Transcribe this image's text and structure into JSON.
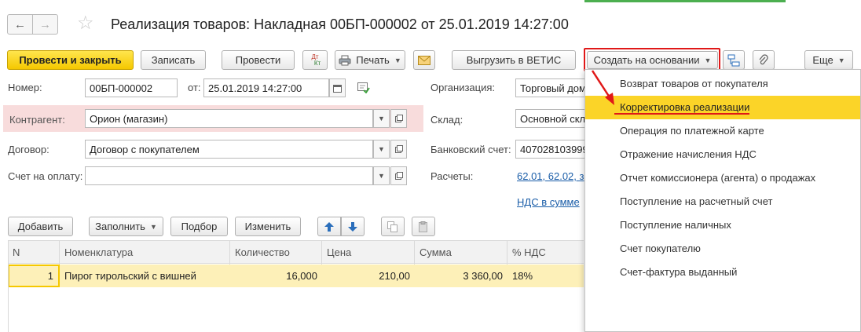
{
  "window": {
    "title": "Реализация товаров: Накладная 00БП-000002 от 25.01.2019 14:27:00",
    "back_glyph": "←",
    "forward_glyph": "→",
    "favorite_glyph": "☆"
  },
  "toolbar": {
    "post_close": "Провести и закрыть",
    "save": "Записать",
    "post": "Провести",
    "dt_kt_top": "Дт",
    "dt_kt_bottom": "Кт",
    "print": "Печать",
    "export_vetis": "Выгрузить в ВЕТИС",
    "create_based_on": "Создать на основании",
    "more": "Еще",
    "help": "?"
  },
  "form": {
    "number_label": "Номер:",
    "number_value": "00БП-000002",
    "date_label": "от:",
    "date_value": "25.01.2019 14:27:00",
    "org_label": "Организация:",
    "org_value": "Торговый дом",
    "counterparty_label": "Контрагент:",
    "counterparty_value": "Орион (магазин)",
    "warehouse_label": "Склад:",
    "warehouse_value": "Основной скл",
    "contract_label": "Договор:",
    "contract_value": "Договор с покупателем",
    "bank_label": "Банковский счет:",
    "bank_value": "407028103999",
    "invoice_label": "Счет на оплату:",
    "invoice_value": "",
    "settlements_label": "Расчеты:",
    "settlements_link": "62.01, 62.02, з",
    "vat_link": "НДС в сумме"
  },
  "table_toolbar": {
    "add": "Добавить",
    "fill": "Заполнить",
    "select": "Подбор",
    "change": "Изменить"
  },
  "table": {
    "columns": [
      "N",
      "Номенклатура",
      "Количество",
      "Цена",
      "Сумма",
      "% НДС"
    ],
    "rows": [
      [
        "1",
        "Пирог тирольский с вишней",
        "16,000",
        "210,00",
        "3 360,00",
        "18%"
      ]
    ]
  },
  "dropdown": {
    "items": [
      "Возврат товаров от покупателя",
      "Корректировка реализации",
      "Операция по платежной карте",
      "Отражение начисления НДС",
      "Отчет комиссионера (агента) о продажах",
      "Поступление на расчетный счет",
      "Поступление наличных",
      "Счет покупателю",
      "Счет-фактура выданный"
    ],
    "highlighted_index": 1
  },
  "colors": {
    "primary_button": "#f5c800",
    "highlight": "#fbd428",
    "annotation_red": "#e01818",
    "link": "#1a5da8",
    "selected_row": "#fdf0b8",
    "required_bg": "#f8dcdc"
  }
}
